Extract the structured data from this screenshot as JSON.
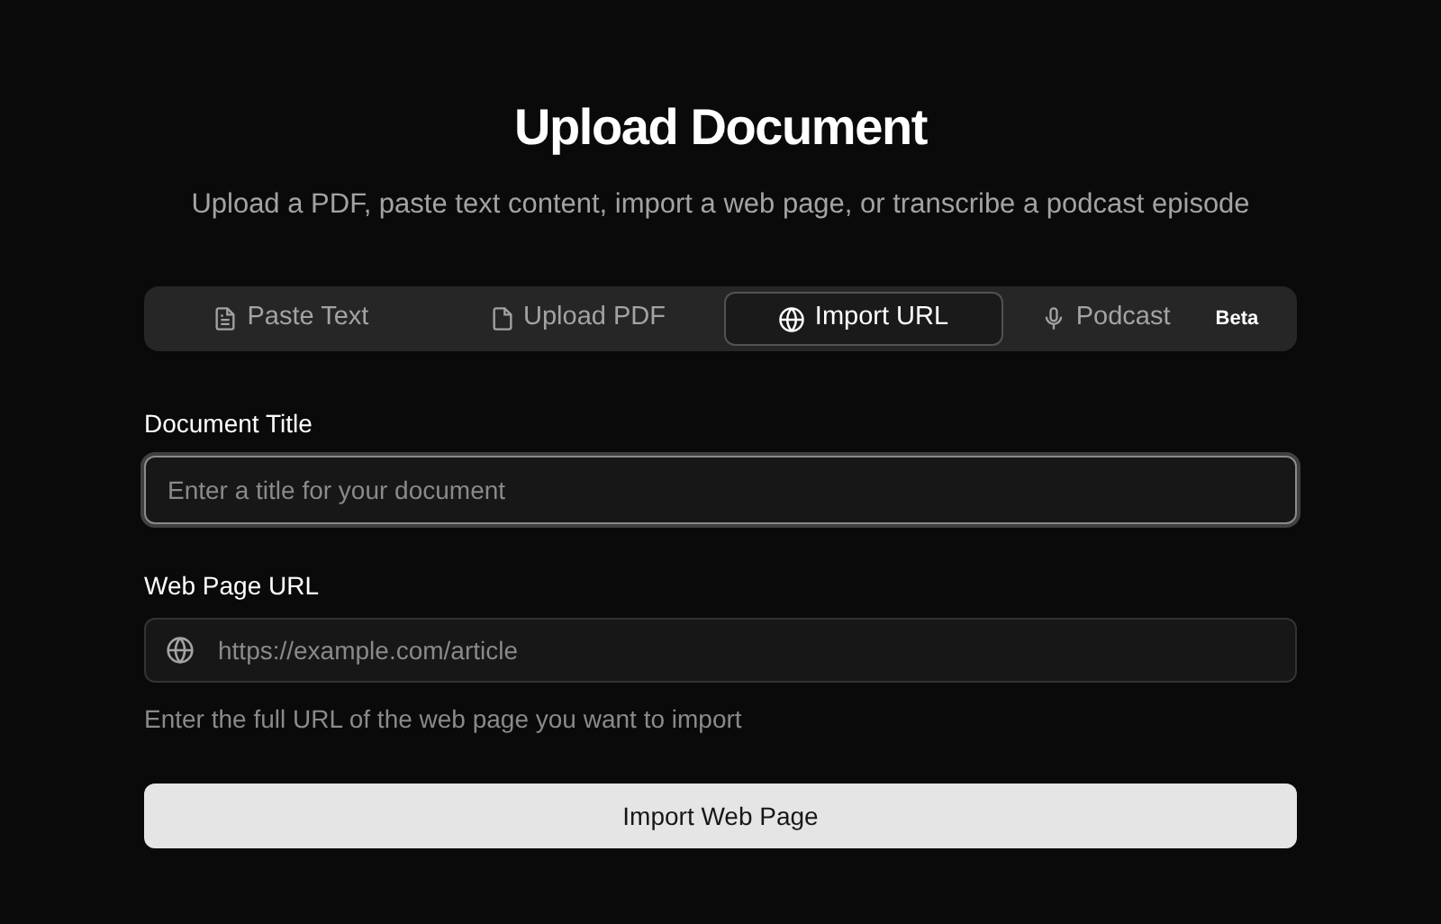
{
  "heading": "Upload Document",
  "subtitle": "Upload a PDF, paste text content, import a web page, or transcribe a podcast episode",
  "tabs": [
    {
      "kind": "text",
      "label": "Paste Text",
      "selected": false
    },
    {
      "kind": "pdf",
      "label": "Upload PDF",
      "selected": false
    },
    {
      "kind": "url",
      "label": "Import URL",
      "selected": true
    },
    {
      "kind": "podcast",
      "label": "Podcast",
      "badge": "Beta",
      "selected": false
    }
  ],
  "title_field": {
    "label": "Document Title",
    "placeholder": "Enter a title for your document",
    "focused": true
  },
  "url_field": {
    "label": "Web Page URL",
    "placeholder": "https://example.com/article",
    "hint": "Enter the full URL of the web page you want to import",
    "focused": false
  },
  "submit_button": "Import Web Page"
}
